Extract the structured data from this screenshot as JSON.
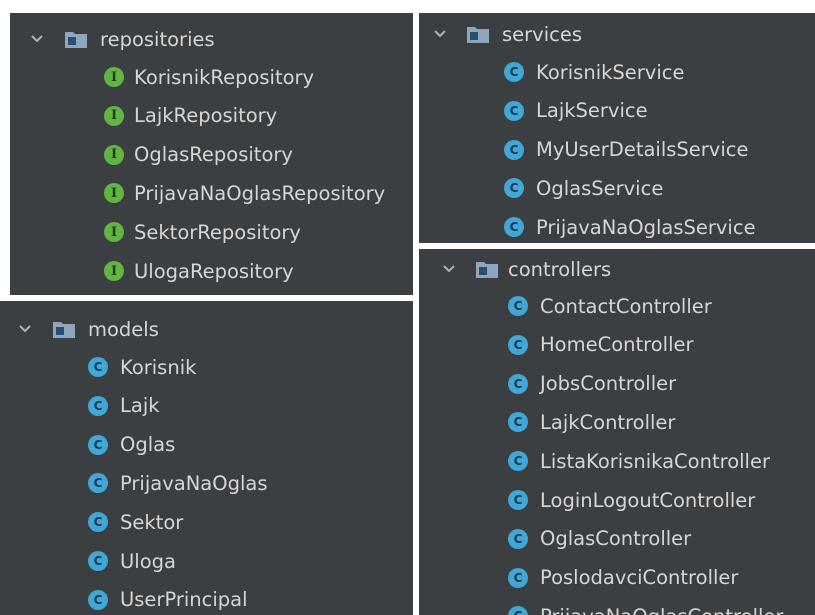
{
  "repositories": {
    "folder_label": "repositories",
    "icon": "interface-icon",
    "items": [
      "KorisnikRepository",
      "LajkRepository",
      "OglasRepository",
      "PrijavaNaOglasRepository",
      "SektorRepository",
      "UlogaRepository"
    ]
  },
  "models": {
    "folder_label": "models",
    "icon": "class-icon",
    "items": [
      "Korisnik",
      "Lajk",
      "Oglas",
      "PrijavaNaOglas",
      "Sektor",
      "Uloga",
      "UserPrincipal"
    ]
  },
  "services": {
    "folder_label": "services",
    "icon": "class-icon",
    "items": [
      "KorisnikService",
      "LajkService",
      "MyUserDetailsService",
      "OglasService",
      "PrijavaNaOglasService"
    ]
  },
  "controllers": {
    "folder_label": "controllers",
    "icon": "class-icon",
    "items": [
      "ContactController",
      "HomeController",
      "JobsController",
      "LajkController",
      "ListaKorisnikaController",
      "LoginLogoutController",
      "OglasController",
      "PoslodavciController",
      "PrijavaNaOglasController"
    ]
  },
  "colors": {
    "panel_bg": "#3c3f41",
    "text": "#d4d6d8",
    "interface_badge": "#62b543",
    "class_badge": "#40a7d6",
    "separator": "#ffffff"
  }
}
